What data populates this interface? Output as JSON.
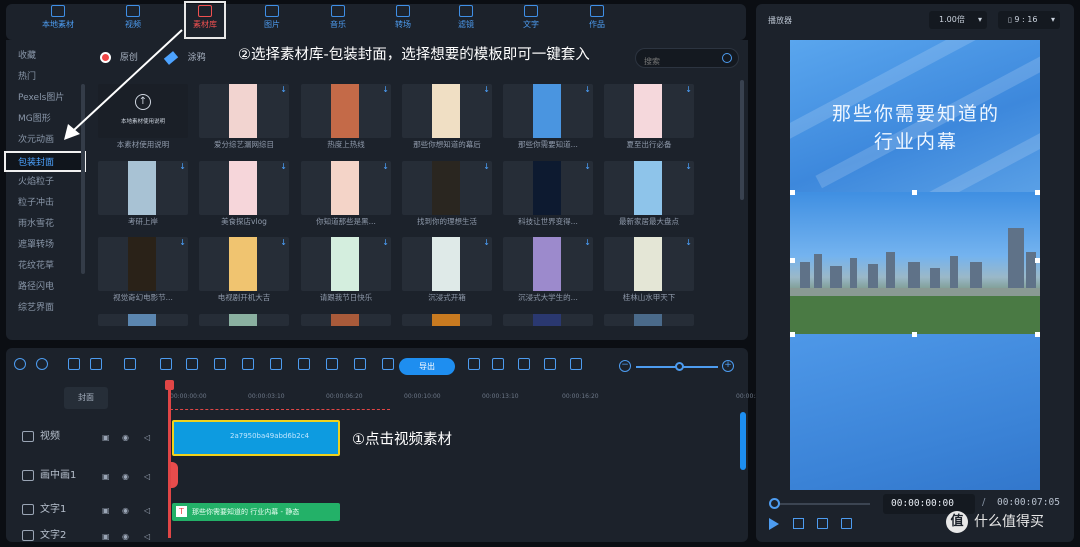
{
  "top_tabs": [
    {
      "label": "本地素材",
      "icon": "folder-icon"
    },
    {
      "label": "视频",
      "icon": "film-icon"
    },
    {
      "label": "素材库",
      "icon": "material-library-icon",
      "selected": true
    },
    {
      "label": "图片",
      "icon": "image-icon"
    },
    {
      "label": "音乐",
      "icon": "music-icon"
    },
    {
      "label": "转场",
      "icon": "transition-icon"
    },
    {
      "label": "滤镜",
      "icon": "filter-icon"
    },
    {
      "label": "文字",
      "icon": "text-icon"
    },
    {
      "label": "作品",
      "icon": "works-folder-icon"
    }
  ],
  "left_nav": [
    {
      "label": "收藏"
    },
    {
      "label": "热门"
    },
    {
      "label": "Pexels图片"
    },
    {
      "label": "MG图形"
    },
    {
      "label": "次元动画"
    },
    {
      "label": "包装封面",
      "selected": true
    },
    {
      "label": "火焰粒子"
    },
    {
      "label": "粒子冲击"
    },
    {
      "label": "雨水雪花"
    },
    {
      "label": "遮罩转场"
    },
    {
      "label": "花纹花草"
    },
    {
      "label": "路径闪电"
    },
    {
      "label": "综艺界面"
    }
  ],
  "filter": {
    "original": "原创",
    "draw": "涂鸦"
  },
  "annotation_top": "②选择素材库-包装封面，选择想要的模板即可一键套入",
  "annotation_timeline": "①点击视频素材",
  "search": {
    "placeholder": "搜索"
  },
  "upload_card": {
    "text": "本地素材使用说明",
    "sublabel": "本地素材使用说明"
  },
  "cards": [
    {
      "caption": "本素材使用说明",
      "color": "#1a1f27"
    },
    {
      "caption": "爱分综艺漏网综目",
      "color": "#f2d4d0"
    },
    {
      "caption": "热度上热线",
      "color": "#c46a48"
    },
    {
      "caption": "那些你想知道的幕后",
      "color": "#f0dfc4"
    },
    {
      "caption": "那些你需要知道...",
      "color": "#4a95e0"
    },
    {
      "caption": "夏至出行必备",
      "color": "#f5d8dc"
    },
    {
      "caption": "考研上岸",
      "color": "#a8c2d4"
    },
    {
      "caption": "美食探店vlog",
      "color": "#f6d6da"
    },
    {
      "caption": "你知道那些是黑...",
      "color": "#f4d4c8"
    },
    {
      "caption": "找到你的理想生活",
      "color": "#2a2620"
    },
    {
      "caption": "科技让世界变得...",
      "color": "#0d1a30"
    },
    {
      "caption": "最新家居最大盘点",
      "color": "#8ec4ea"
    },
    {
      "caption": "视觉奇幻电影节...",
      "color": "#2a2218"
    },
    {
      "caption": "电视剧开机大吉",
      "color": "#f0c470"
    },
    {
      "caption": "请跟我节日快乐",
      "color": "#d4eede"
    },
    {
      "caption": "沉浸式开箱",
      "color": "#dfeae8"
    },
    {
      "caption": "沉浸式大学生的...",
      "color": "#9c8acc"
    },
    {
      "caption": "桂林山水甲天下",
      "color": "#e4e6d6"
    }
  ],
  "partial_cards": [
    "#5b86b0",
    "#8ab0a0",
    "#a85a3a",
    "#c87a20",
    "#2a3870",
    "#4a6a8a",
    "#a0b4a0"
  ],
  "edit": {
    "export": "导出"
  },
  "timeline": {
    "cover": "封面",
    "ticks": [
      "00:00:00:00",
      "00:00:03:10",
      "00:00:06:20",
      "00:00:10:00",
      "00:00:13:10",
      "00:00:16:20",
      "00:00:2"
    ],
    "tracks": [
      {
        "name": "视频",
        "icon": "video-track-icon"
      },
      {
        "name": "画中画1",
        "icon": "pip-track-icon"
      },
      {
        "name": "文字1",
        "icon": "text-track-icon"
      },
      {
        "name": "文字2",
        "icon": "text-track-icon"
      }
    ],
    "video_clip": "2a7950ba49abd6b2c4",
    "text_clip": "那些你需要知道的 行业内幕 - 静态"
  },
  "player": {
    "title": "播放器",
    "zoom": "1.00倍",
    "ratio": "9 : 16",
    "headline_line1": "那些你需要知道的",
    "headline_line2": "行业内幕",
    "current_time": "00:00:00:00",
    "separator": "/",
    "total_time": "00:00:07:05"
  },
  "watermark": {
    "logo": "值",
    "text": "什么值得买"
  }
}
